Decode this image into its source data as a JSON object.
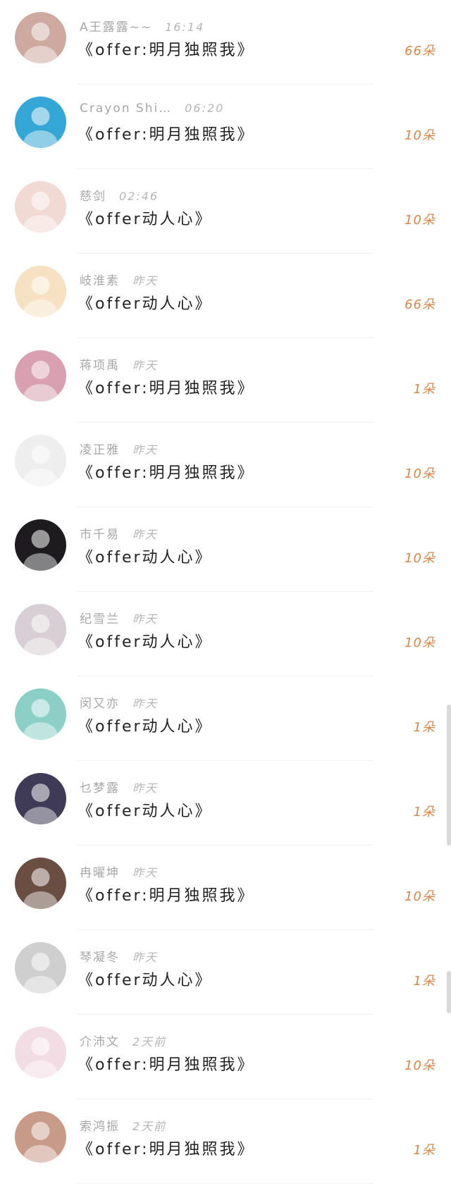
{
  "gifts": [
    {
      "name": "A王露露~~",
      "time": "16:14",
      "gift": "《offer:明月独照我》",
      "amount": "66朵",
      "avatar_color": "#cda9a0"
    },
    {
      "name": "Crayon Shi…",
      "time": "06:20",
      "gift": "《offer:明月独照我》",
      "amount": "10朵",
      "avatar_color": "#35a7d6"
    },
    {
      "name": "慈剑",
      "time": "02:46",
      "gift": "《offer动人心》",
      "amount": "10朵",
      "avatar_color": "#f1d9d4"
    },
    {
      "name": "岐淮素",
      "time": "昨天",
      "gift": "《offer动人心》",
      "amount": "66朵",
      "avatar_color": "#f6e2c2"
    },
    {
      "name": "蒋项禹",
      "time": "昨天",
      "gift": "《offer:明月独照我》",
      "amount": "1朵",
      "avatar_color": "#d8a0b0"
    },
    {
      "name": "凌正雅",
      "time": "昨天",
      "gift": "《offer:明月独照我》",
      "amount": "10朵",
      "avatar_color": "#eeeeee"
    },
    {
      "name": "市千易",
      "time": "昨天",
      "gift": "《offer动人心》",
      "amount": "10朵",
      "avatar_color": "#1d1b1e"
    },
    {
      "name": "纪雪兰",
      "time": "昨天",
      "gift": "《offer动人心》",
      "amount": "10朵",
      "avatar_color": "#d7cfd3"
    },
    {
      "name": "闵又亦",
      "time": "昨天",
      "gift": "《offer动人心》",
      "amount": "1朵",
      "avatar_color": "#8ccfc7"
    },
    {
      "name": "乜梦露",
      "time": "昨天",
      "gift": "《offer动人心》",
      "amount": "1朵",
      "avatar_color": "#3f3a55"
    },
    {
      "name": "冉曜坤",
      "time": "昨天",
      "gift": "《offer:明月独照我》",
      "amount": "10朵",
      "avatar_color": "#6b4e42"
    },
    {
      "name": "琴凝冬",
      "time": "昨天",
      "gift": "《offer动人心》",
      "amount": "1朵",
      "avatar_color": "#cfcfcf"
    },
    {
      "name": "介沛文",
      "time": "2天前",
      "gift": "《offer:明月独照我》",
      "amount": "10朵",
      "avatar_color": "#f3dde4"
    },
    {
      "name": "索鸿振",
      "time": "2天前",
      "gift": "《offer:明月独照我》",
      "amount": "1朵",
      "avatar_color": "#c89a88"
    }
  ]
}
